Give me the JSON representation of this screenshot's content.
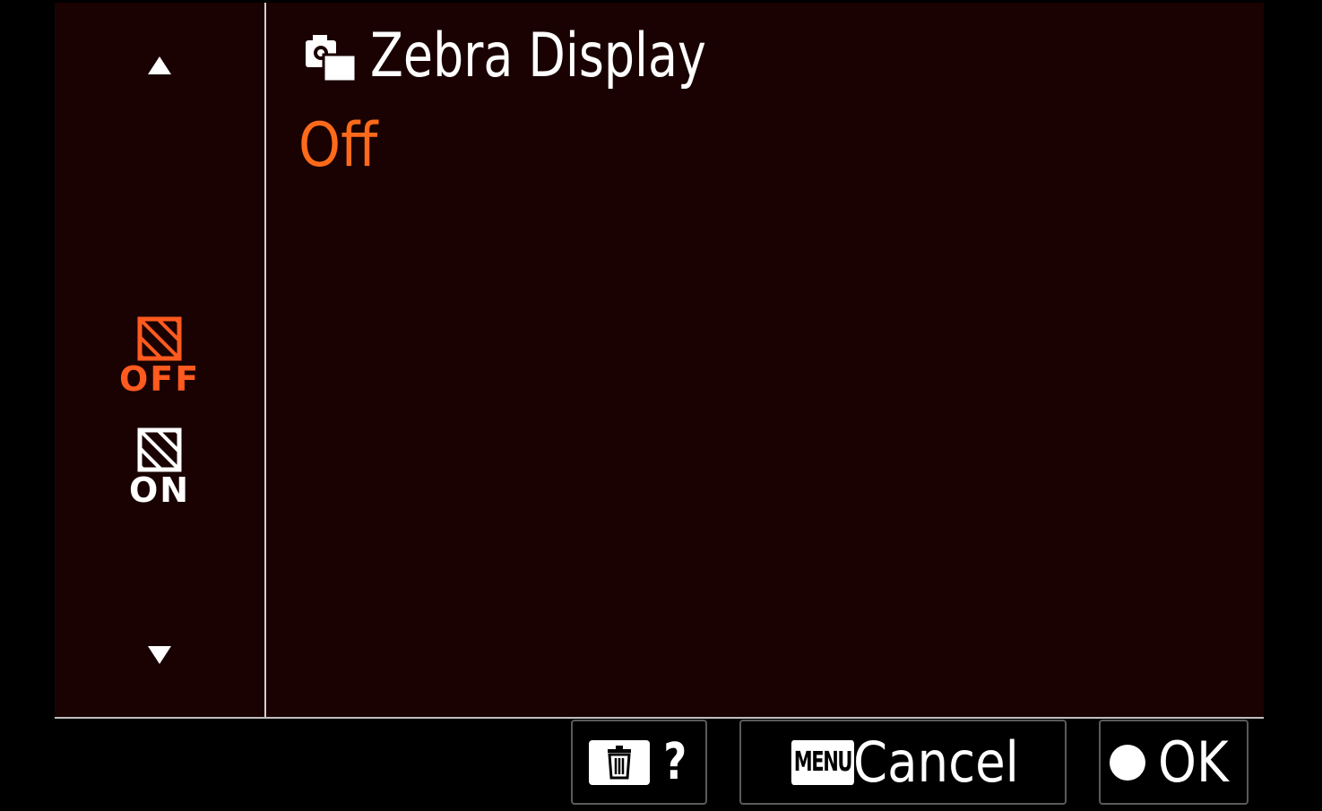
{
  "screen": {
    "title": "Zebra Display",
    "title_icon": "camera-custom-icon",
    "current_value": "Off"
  },
  "sidebar": {
    "options": [
      {
        "label": "OFF",
        "icon": "zebra-off-icon",
        "selected": true
      },
      {
        "label": "ON",
        "icon": "zebra-on-icon",
        "selected": false
      }
    ]
  },
  "footer": {
    "help_label": "?",
    "cancel_badge": "MENU",
    "cancel_label": "Cancel",
    "ok_label": "OK"
  },
  "colors": {
    "accent": "#ff5a1f",
    "background": "#1a0202"
  }
}
